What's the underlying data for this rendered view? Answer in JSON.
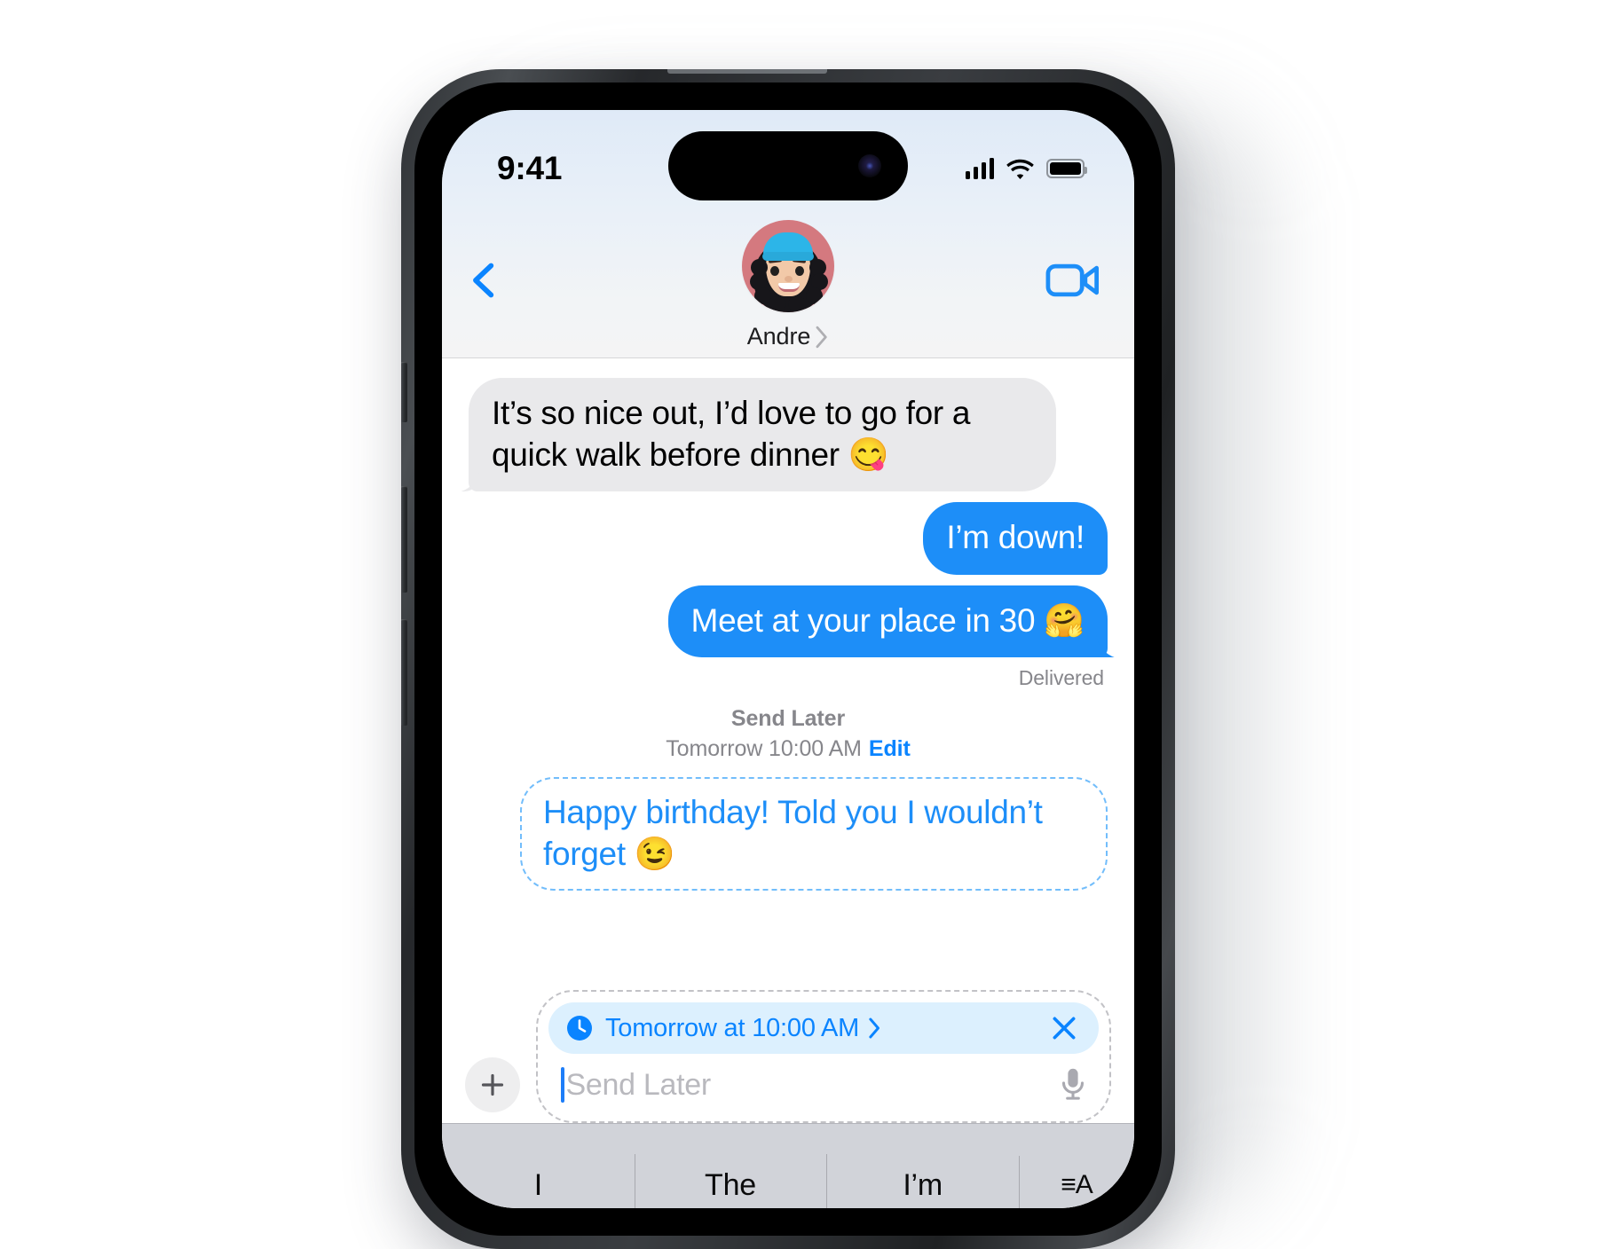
{
  "status_bar": {
    "time": "9:41",
    "cellular_icon": "cellular-signal-icon",
    "wifi_icon": "wifi-icon",
    "battery_icon": "battery-full-icon"
  },
  "nav": {
    "back_icon": "back-chevron-icon",
    "facetime_icon": "video-camera-icon",
    "contact_name": "Andre",
    "contact_chevron": "chevron-right-icon",
    "avatar_label": "memoji-avatar"
  },
  "messages": [
    {
      "id": "msg-1",
      "direction": "incoming",
      "text": "It’s so nice out, I’d love to go for a quick walk before dinner 😋"
    },
    {
      "id": "msg-2",
      "direction": "outgoing",
      "text": "I’m down!"
    },
    {
      "id": "msg-3",
      "direction": "outgoing",
      "text": "Meet at your place in 30 🤗"
    }
  ],
  "delivery_status": "Delivered",
  "send_later": {
    "title": "Send Later",
    "time_label": "Tomorrow 10:00 AM",
    "edit_label": "Edit",
    "scheduled_message": "Happy birthday! Told you I wouldn’t forget 😉"
  },
  "composer": {
    "plus_icon": "plus-icon",
    "schedule_clock_icon": "clock-icon",
    "schedule_label": "Tomorrow at 10:00 AM",
    "schedule_chevron": "chevron-right-icon",
    "schedule_close_icon": "close-x-icon",
    "input_placeholder": "Send Later",
    "mic_icon": "microphone-icon"
  },
  "keyboard": {
    "predictions": [
      "I",
      "The",
      "I’m"
    ],
    "emoji_toggle": "≡A"
  },
  "colors": {
    "imessage_blue": "#1d8ef8",
    "action_blue": "#0a84ff",
    "incoming_gray": "#e9e9eb",
    "scheduled_dash": "#72bdfb",
    "schedule_pill_bg": "#dcf0fe",
    "keyboard_bg": "#d1d3d9"
  }
}
